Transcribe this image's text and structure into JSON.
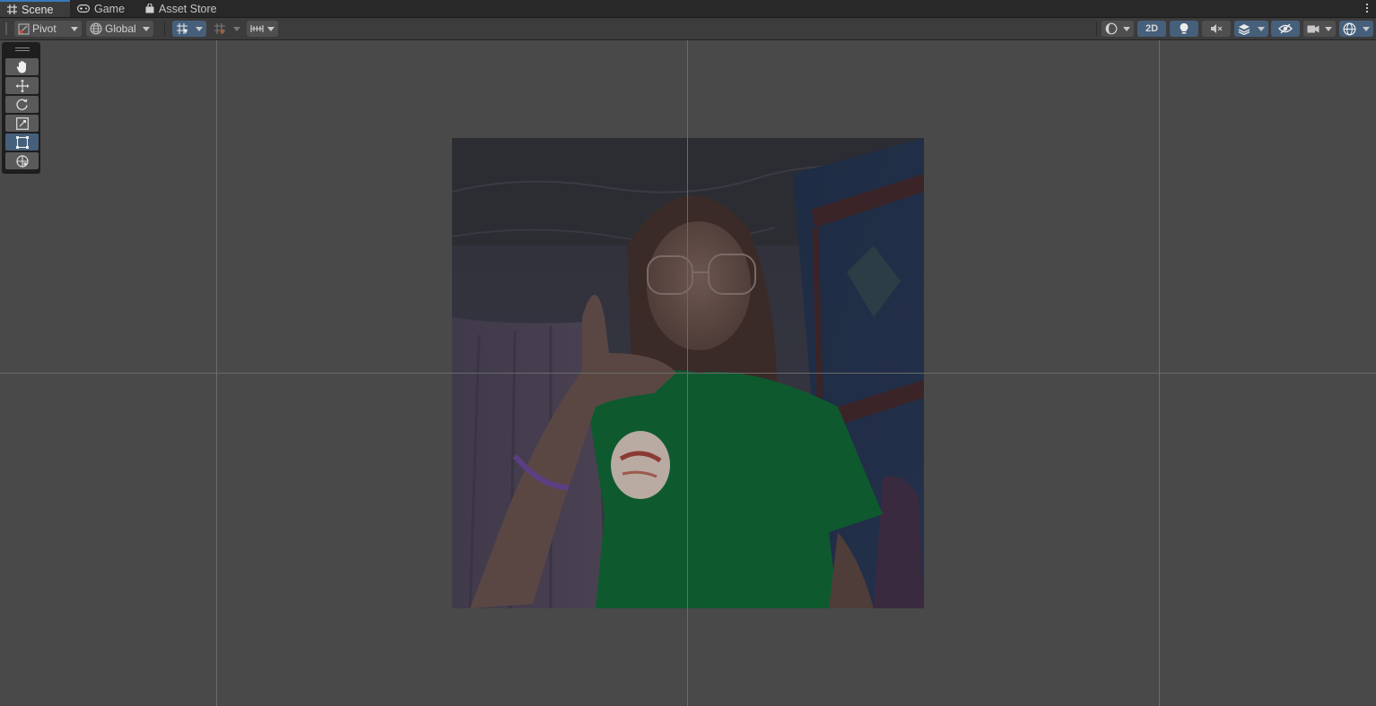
{
  "tabs": [
    {
      "label": "Scene",
      "icon": "hash-grid-icon",
      "active": true
    },
    {
      "label": "Game",
      "icon": "gamepad-icon",
      "active": false
    },
    {
      "label": "Asset Store",
      "icon": "shopping-bag-icon",
      "active": false
    }
  ],
  "toolbar": {
    "pivot_label": "Pivot",
    "global_label": "Global",
    "mode_2d_label": "2D"
  },
  "tools": [
    "hand-tool",
    "move-tool",
    "rotate-tool",
    "scale-tool",
    "rect-tool",
    "transform-tool"
  ],
  "active_tool": "rect-tool",
  "colors": {
    "accent": "#3a79bb",
    "active_button": "#46607c",
    "scene_background": "#494949"
  }
}
